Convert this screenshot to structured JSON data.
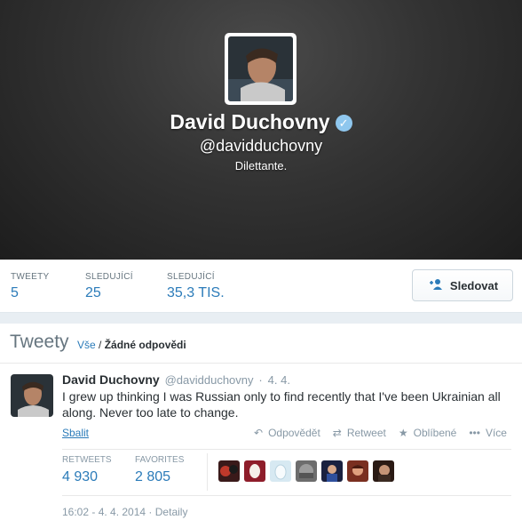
{
  "profile": {
    "name": "David Duchovny",
    "handle": "@davidduchovny",
    "bio": "Dilettante."
  },
  "stats": [
    {
      "label": "TWEETY",
      "value": "5"
    },
    {
      "label": "SLEDUJÍCÍ",
      "value": "25"
    },
    {
      "label": "SLEDUJÍCÍ",
      "value": "35,3 TIS."
    }
  ],
  "follow_button": {
    "label": "Sledovat"
  },
  "stream": {
    "title": "Tweety",
    "filter_all": "Vše",
    "filter_sep": " / ",
    "filter_selected": "Žádné odpovědi"
  },
  "tweet": {
    "author_name": "David Duchovny",
    "author_handle": "@davidduchovny",
    "date": "4. 4.",
    "text": "I grew up thinking I was Russian only to find recently that I've been Ukrainian all along. Never too late to change.",
    "collapse_label": "Sbalit",
    "actions": {
      "reply": "Odpovědět",
      "retweet": "Retweet",
      "favorite": "Oblíbené",
      "more": "Více"
    },
    "retweets_label": "RETWEETS",
    "retweets_value": "4 930",
    "favorites_label": "FAVORITES",
    "favorites_value": "2 805",
    "timestamp": "16:02 - 4. 4. 2014",
    "details_label": "Detaily"
  },
  "colors": {
    "link": "#2b7bb9",
    "muted": "#8899a6",
    "text": "#292f33",
    "verified": "#8fc7ee"
  }
}
